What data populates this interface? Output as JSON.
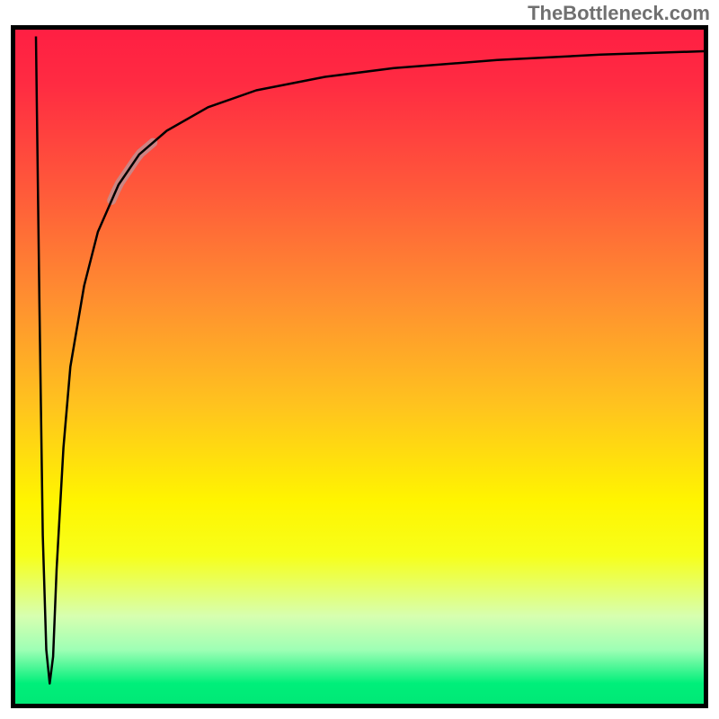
{
  "watermark": "TheBottleneck.com",
  "chart_data": {
    "type": "line",
    "title": "",
    "xlabel": "",
    "ylabel": "",
    "grid": false,
    "legend": false,
    "x_range": [
      0,
      100
    ],
    "y_range": [
      0,
      100
    ],
    "gradient_stops": [
      {
        "pos": 0,
        "color": "#ff1f43"
      },
      {
        "pos": 24,
        "color": "#ff5a3a"
      },
      {
        "pos": 56,
        "color": "#ffc41e"
      },
      {
        "pos": 70,
        "color": "#fff500"
      },
      {
        "pos": 92,
        "color": "#9effb5"
      },
      {
        "pos": 100,
        "color": "#00e876"
      }
    ],
    "series": [
      {
        "name": "curve",
        "points": [
          {
            "x": 3.0,
            "y": 99.0
          },
          {
            "x": 3.5,
            "y": 60.0
          },
          {
            "x": 4.0,
            "y": 25.0
          },
          {
            "x": 4.5,
            "y": 8.0
          },
          {
            "x": 5.0,
            "y": 3.0
          },
          {
            "x": 5.5,
            "y": 7.0
          },
          {
            "x": 6.0,
            "y": 20.0
          },
          {
            "x": 7.0,
            "y": 38.0
          },
          {
            "x": 8.0,
            "y": 50.0
          },
          {
            "x": 10.0,
            "y": 62.0
          },
          {
            "x": 12.0,
            "y": 70.0
          },
          {
            "x": 15.0,
            "y": 77.0
          },
          {
            "x": 18.0,
            "y": 81.5
          },
          {
            "x": 22.0,
            "y": 85.0
          },
          {
            "x": 28.0,
            "y": 88.5
          },
          {
            "x": 35.0,
            "y": 91.0
          },
          {
            "x": 45.0,
            "y": 93.0
          },
          {
            "x": 55.0,
            "y": 94.3
          },
          {
            "x": 70.0,
            "y": 95.5
          },
          {
            "x": 85.0,
            "y": 96.3
          },
          {
            "x": 100.0,
            "y": 96.8
          }
        ]
      }
    ],
    "highlight_segment": {
      "description": "light desaturated red segment on rising part of curve",
      "x_start": 14,
      "x_end": 20
    }
  }
}
